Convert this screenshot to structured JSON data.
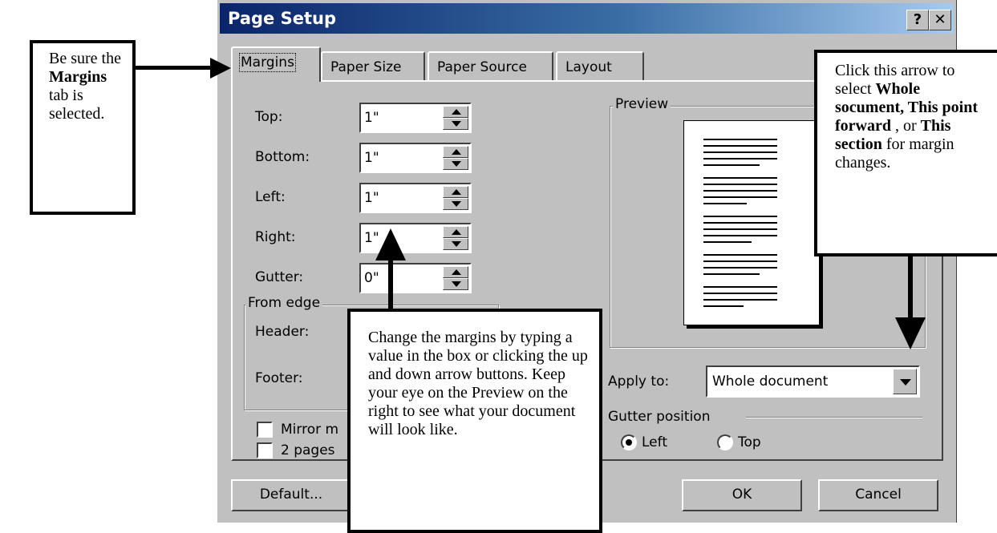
{
  "dialog": {
    "title": "Page Setup",
    "help_button": "?",
    "close_button": "✕",
    "tabs": [
      {
        "label": "Margins",
        "active": true
      },
      {
        "label": "Paper Size",
        "active": false
      },
      {
        "label": "Paper Source",
        "active": false
      },
      {
        "label": "Layout",
        "active": false
      }
    ],
    "fields": [
      {
        "label": "Top:",
        "value": "1\""
      },
      {
        "label": "Bottom:",
        "value": "1\""
      },
      {
        "label": "Left:",
        "value": "1\""
      },
      {
        "label": "Right:",
        "value": "1\""
      },
      {
        "label": "Gutter:",
        "value": "0\""
      }
    ],
    "from_edge": {
      "group_label": "From edge",
      "header_label": "Header:",
      "footer_label": "Footer:"
    },
    "checkboxes": [
      {
        "label": "Mirror m",
        "checked": false
      },
      {
        "label": "2 pages",
        "checked": false
      }
    ],
    "preview_label": "Preview",
    "apply_to": {
      "label": "Apply to:",
      "value": "Whole document"
    },
    "gutter_position": {
      "label": "Gutter position",
      "options": [
        {
          "label": "Left",
          "selected": true
        },
        {
          "label": "Top",
          "selected": false
        }
      ]
    },
    "buttons": {
      "default": "Default...",
      "ok": "OK",
      "cancel": "Cancel"
    }
  },
  "callouts": {
    "margins_tab": {
      "p1": "Be sure the ",
      "b1": "Margins",
      "p2": " tab is selected."
    },
    "apply_arrow": {
      "p1": "Click this arrow to select ",
      "b1": "Whole socument, This point forward",
      "p2": " , or ",
      "b2": "This section",
      "p3": " for margin changes."
    },
    "change_margins": {
      "text": "Change the margins by typing a value in the box or clicking the up and down arrow buttons.  Keep your eye on the Preview on the right to see what your document will look like."
    }
  },
  "colors": {
    "dialog_face": "#c0c0c0",
    "titlebar_start": "#0a246a",
    "titlebar_end": "#a6caf0"
  }
}
